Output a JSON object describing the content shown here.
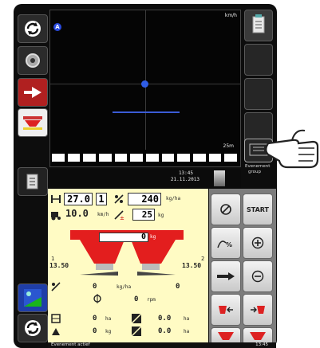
{
  "map": {
    "speed_unit": "km/h",
    "scale_label": "25m",
    "north_marker": "A"
  },
  "header": {
    "time": "13:45",
    "date": "21.11.2013"
  },
  "callout": {
    "line1": "Evenement",
    "line2": "group"
  },
  "work": {
    "width_value": "27.0",
    "width_count": "1",
    "rate_value": "240",
    "rate_unit": "kg/ha",
    "speed_value": "10.0",
    "speed_unit": "km/h",
    "step_value": "25",
    "step_unit": "kg",
    "hopper_value": "0",
    "hopper_unit": "kg",
    "left_disc_index": "1",
    "left_disc_value": "13.50",
    "right_disc_index": "2",
    "right_disc_value": "13.50",
    "flow_value": "0",
    "flow_unit": "kg/ha",
    "rpm_value": "0",
    "rpm_unit": "rpm",
    "area_value": "0",
    "area_unit": "ha",
    "area_total": "0.0",
    "area_total_unit": "ha",
    "weight_value": "0",
    "weight_unit": "kg",
    "weight_total": "0.0",
    "weight_total_unit": "ha"
  },
  "softkeys": {
    "start_label": "START"
  },
  "status": {
    "text": "Evenement actief",
    "right_text": "13:45"
  },
  "colors": {
    "hopper_red": "#e31e1e",
    "panel_yellow": "#fffbc4",
    "softkey_grey": "#7c7c7c",
    "map_line": "#3b5bd6"
  }
}
